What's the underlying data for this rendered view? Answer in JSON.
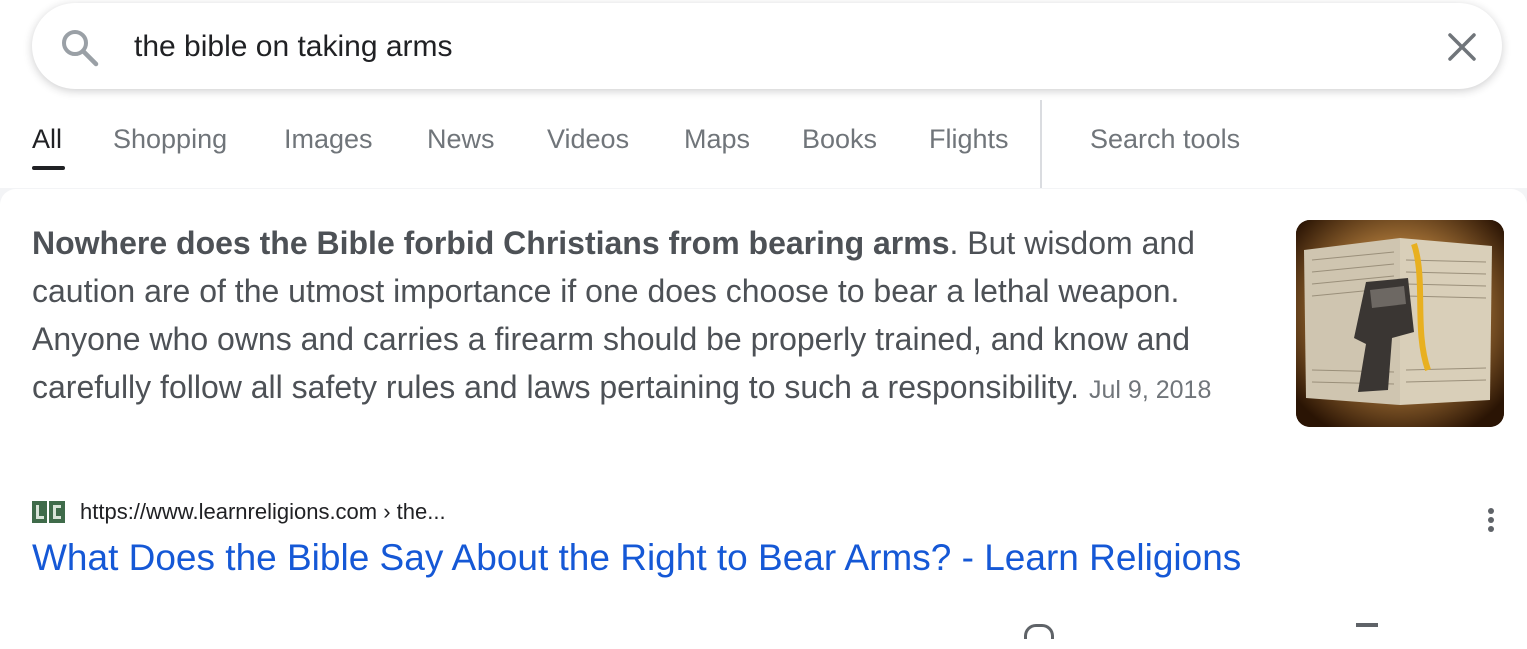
{
  "search": {
    "query": "the bible on taking arms",
    "icon": "search-icon",
    "clear_icon": "close-icon"
  },
  "tabs": [
    {
      "label": "All",
      "active": true
    },
    {
      "label": "Shopping"
    },
    {
      "label": "Images"
    },
    {
      "label": "News"
    },
    {
      "label": "Videos"
    },
    {
      "label": "Maps"
    },
    {
      "label": "Books"
    },
    {
      "label": "Flights"
    }
  ],
  "search_tools_label": "Search tools",
  "featured_snippet": {
    "bold_text": "Nowhere does the Bible forbid Christians from bearing arms",
    "rest_text": ". But wisdom and caution are of the utmost importance if one does choose to bear a lethal weapon. Anyone who owns and carries a firearm should be properly trained, and know and carefully follow all safety rules and laws pertaining to such a responsibility.",
    "date": "Jul 9, 2018",
    "image_icon": "bible-with-handgun-image"
  },
  "result": {
    "favicon": "learnreligions-favicon",
    "url": "https://www.learnreligions.com › the...",
    "title": "What Does the Bible Say About the Right to Bear Arms? - Learn Religions",
    "more_icon": "more-vert-icon"
  },
  "colors": {
    "link": "#1558d6",
    "text": "#4d5156",
    "muted": "#70757a",
    "background": "#f3f4f6"
  }
}
